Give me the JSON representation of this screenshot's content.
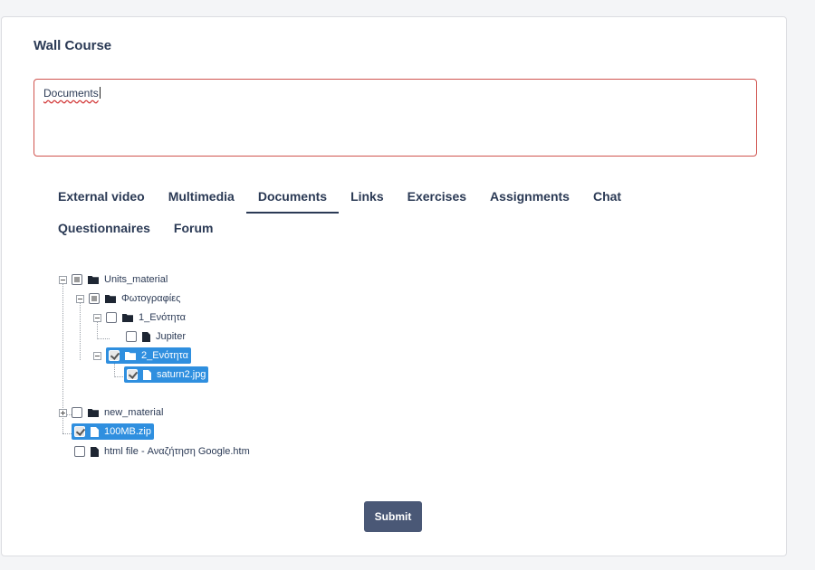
{
  "course": {
    "title": "Wall Course"
  },
  "editor": {
    "value": "Documents"
  },
  "tabs": [
    "External video",
    "Multimedia",
    "Documents",
    "Links",
    "Exercises",
    "Assignments",
    "Chat",
    "Questionnaires",
    "Forum"
  ],
  "active_tab": "Documents",
  "tree": [
    {
      "label": "Units_material",
      "type": "folder",
      "state": "partial",
      "expander": "minus",
      "selected": false
    },
    {
      "label": "Φωτογραφίες",
      "type": "folder",
      "state": "partial",
      "expander": "minus",
      "selected": false
    },
    {
      "label": "1_Ενότητα",
      "type": "folder",
      "state": "unchecked",
      "expander": "minus",
      "selected": false
    },
    {
      "label": "Jupiter",
      "type": "file",
      "state": "unchecked",
      "expander": "none",
      "selected": false
    },
    {
      "label": "2_Ενότητα",
      "type": "folder",
      "state": "checked",
      "expander": "minus",
      "selected": true
    },
    {
      "label": "saturn2.jpg",
      "type": "file",
      "state": "checked",
      "expander": "none",
      "selected": true
    },
    {
      "label": "new_material",
      "type": "folder",
      "state": "unchecked",
      "expander": "plus",
      "selected": false
    },
    {
      "label": "100MB.zip",
      "type": "file",
      "state": "checked",
      "expander": "none",
      "selected": true
    },
    {
      "label": "html file - Αναζήτηση Google.htm",
      "type": "file",
      "state": "unchecked",
      "expander": "none",
      "selected": false
    }
  ],
  "actions": {
    "submit_label": "Submit"
  },
  "colors": {
    "accent": "#2b3a55",
    "selection": "#2f8fdf",
    "button": "#4a5876",
    "error_border": "#d0544f"
  }
}
